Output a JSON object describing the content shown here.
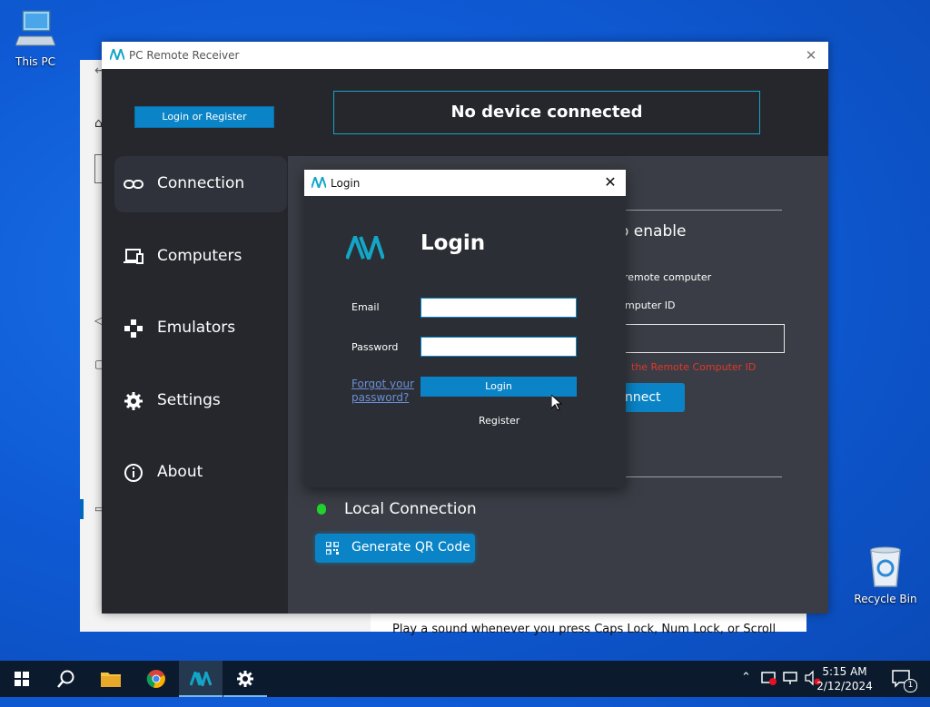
{
  "desktop": {
    "this_pc_label": "This PC",
    "recycle_bin_label": "Recycle Bin"
  },
  "background_window": {
    "bottom_text": "Play a sound whenever you press Caps Lock, Num Lock, or Scroll"
  },
  "app": {
    "title": "PC Remote Receiver",
    "login_register_label": "Login or Register",
    "status_text": "No device connected",
    "nav": [
      {
        "label": "Connection",
        "icon": "link-icon"
      },
      {
        "label": "Computers",
        "icon": "computers-icon"
      },
      {
        "label": "Emulators",
        "icon": "gamepad-icon"
      },
      {
        "label": "Settings",
        "icon": "gear-icon"
      },
      {
        "label": "About",
        "icon": "info-icon"
      }
    ],
    "content": {
      "partial_heading": "o enable",
      "partial_remote_computer": "remote computer",
      "partial_computer_id": "mputer ID",
      "partial_error": "the Remote Computer ID",
      "partial_connect": "nnect",
      "local_connection_label": "Local Connection",
      "generate_qr_label": "Generate QR Code"
    }
  },
  "login_dialog": {
    "title": "Login",
    "heading": "Login",
    "email_label": "Email",
    "email_value": "",
    "password_label": "Password",
    "password_value": "",
    "forgot_line1": "Forgot your",
    "forgot_line2": "password?",
    "login_button": "Login",
    "register_link": "Register"
  },
  "taskbar": {
    "time": "5:15 AM",
    "date": "2/12/2024",
    "notification_count": "1"
  },
  "colors": {
    "accent": "#0a84c6",
    "app_bg": "#2b2e35",
    "desktop_blue": "#0f5bd6"
  }
}
